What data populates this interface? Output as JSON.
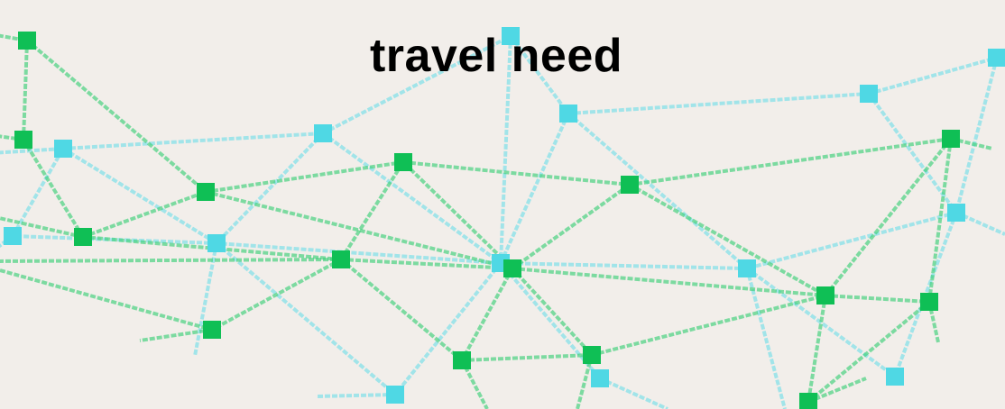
{
  "title": "travel need",
  "colors": {
    "background": "#f2eeea",
    "green": "#14c25a",
    "cyan": "#4fd8e4"
  }
}
